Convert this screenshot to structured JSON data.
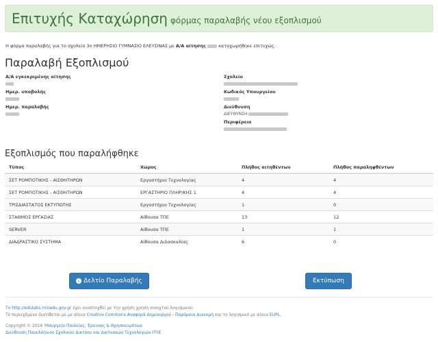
{
  "banner": {
    "title": "Επιτυχής Καταχώρηση",
    "subtitle": "φόρμας παραλαβής νέου εξοπλισμού"
  },
  "intro": {
    "text_before": "Η φόρμα παραλαβής για το σχολείο 3ο ΗΜΕΡΗΣΙΟ ΓΥΜΝΑΣΙΟ ΕΛΕΥΣΙΝΑΣ με",
    "bold": "Α/Α αίτησης",
    "text_after": "καταχωρήθηκε επιτυχώς."
  },
  "receipt": {
    "heading": "Παραλαβή Εξοπλισμού",
    "left": [
      {
        "label": "Α/Α εγκεκριμένης αίτησης"
      },
      {
        "label": "Ημερ. υποβολής"
      },
      {
        "label": "Ημερ. παραλαβής"
      }
    ],
    "right": [
      {
        "label": "Σχολείο"
      },
      {
        "label": "Κωδικός Υπουργείου"
      },
      {
        "label": "Διεύθυνση",
        "value_prefix": "ΔΙΕΥΘΥΝΣΗ"
      },
      {
        "label": "Περιφέρεια"
      }
    ]
  },
  "equipment": {
    "heading": "Εξοπλισμός που παραλήφθηκε",
    "columns": [
      "Τύπος",
      "Χώρος",
      "Πλήθος αιτηθέντων",
      "Πλήθος παραληφθέντων"
    ],
    "rows": [
      [
        "ΣΕΤ ΡΟΜΠΟΤΙΚΗΣ - ΑΙΣΘΗΤΗΡΩΝ",
        "Εργαστήριο Τεχνολογίας",
        "4",
        "4"
      ],
      [
        "ΣΕΤ ΡΟΜΠΟΤΙΚΗΣ - ΑΙΣΘΗΤΗΡΩΝ",
        "ΕΡΓΑΣΤΗΡΙΟ ΠΛΗΡ/ΚΗΣ 1",
        "4",
        "4"
      ],
      [
        "ΤΡΙΣΔΙΑΣΤΑΤΟΣ ΕΚΤΥΠΩΤΗΣ",
        "Εργαστήριο Τεχνολογίας",
        "1",
        "0"
      ],
      [
        "ΣΤΑΘΜΟΣ ΕΡΓΑΣΙΑΣ",
        "Αίθουσα ΤΠΕ",
        "13",
        "12"
      ],
      [
        "SERVER",
        "Αίθουσα ΤΠΕ",
        "1",
        "1"
      ],
      [
        "ΔΙΑΔΡΑΣΤΙΚΟ ΣΥΣΤΗΜΑ",
        "Αίθουσα Διδασκαλίας",
        "6",
        "0"
      ]
    ]
  },
  "buttons": {
    "receipt": "Δελτίο Παραλαβής",
    "print": "Εκτύπωση"
  },
  "footer": {
    "line1_link": "http://edulabs.minedu.gov.gr",
    "line1_rest": "έχει αναπτυχθεί με την χρήση χρήση ανοιχτού λογισμικού.",
    "line2_a": "Το περιεχόμενο διατίθεται με με άδεια",
    "line2_link1": "Creative Commons Αναφορά Δημιουργού - Παρόμοια Διανομή",
    "line2_b": "και το λογισμικό με άδεια",
    "line2_link2": "EUPL.",
    "copyright": "Copyright © 2016",
    "ministry": "Υπουργείο Παιδείας, Έρευνας & Θρησκευμάτων",
    "directorate": "Διεύθυνση Πανελλήνιου Σχολικού Δικτύου και Δικτυακών Τεχνολογιών ΙΤΥΕ"
  },
  "colors": {
    "success_bg": "#dff0d8",
    "success_text": "#3c763d",
    "primary": "#337ab7",
    "link": "#337ab7"
  }
}
